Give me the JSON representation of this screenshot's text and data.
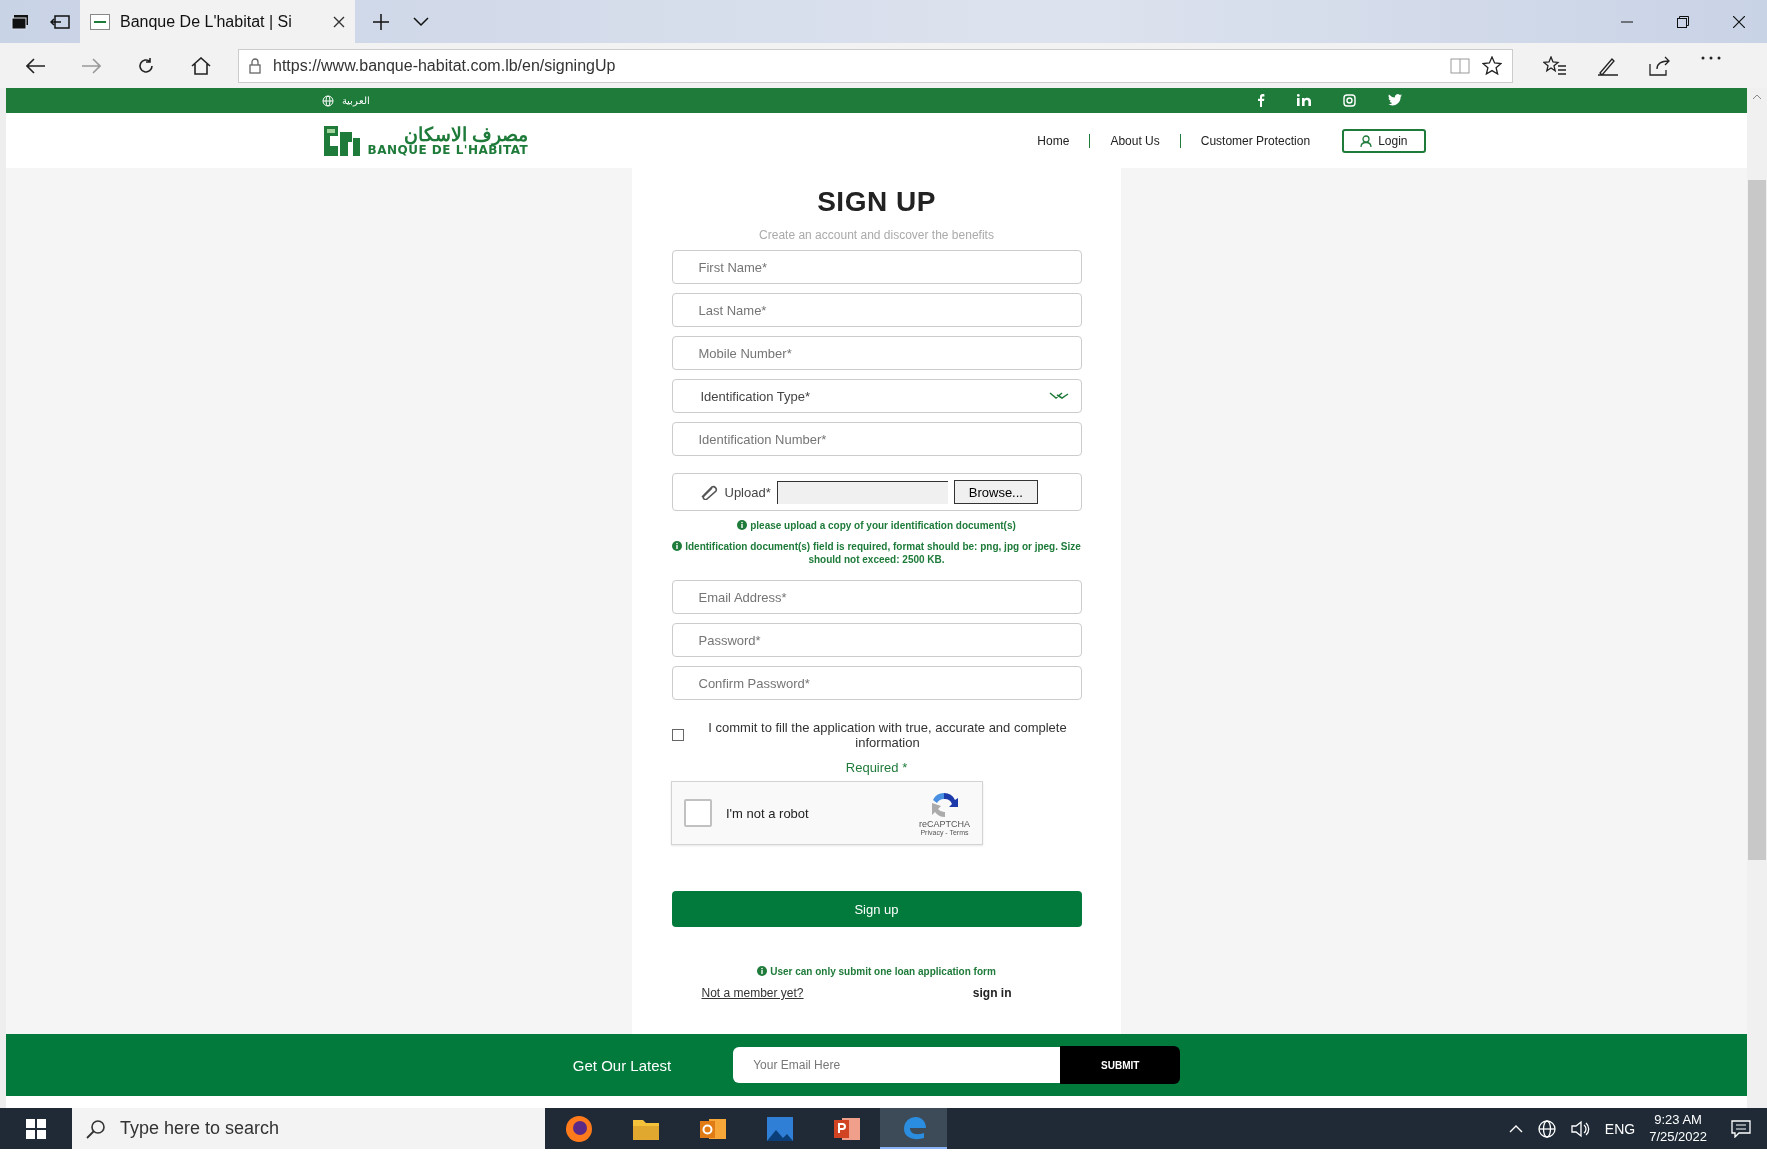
{
  "browser": {
    "tab_title": "Banque De L'habitat | Si",
    "url": "https://www.banque-habitat.com.lb/en/signingUp"
  },
  "top_bar": {
    "language": "العربية"
  },
  "header": {
    "logo_arabic": "مصرف الاسكان",
    "logo_latin": "BANQUE DE L'HABITAT",
    "nav": [
      "Home",
      "About Us",
      "Customer Protection"
    ],
    "login": "Login"
  },
  "form": {
    "title": "SIGN UP",
    "subtitle": "Create an account and discover the benefits",
    "fields": [
      {
        "kind": "text",
        "placeholder": "First Name*"
      },
      {
        "kind": "text",
        "placeholder": "Last Name*"
      },
      {
        "kind": "text",
        "placeholder": "Mobile Number*"
      },
      {
        "kind": "select",
        "placeholder": "Identification Type*"
      },
      {
        "kind": "text",
        "placeholder": "Identification Number*"
      },
      {
        "kind": "upload",
        "label": "Upload*",
        "button": "Browse..."
      }
    ],
    "upload_notes": [
      "please upload a copy of your identification document(s)",
      "Identification document(s) field is required, format should be: png, jpg or jpeg. Size should not exceed: 2500 KB."
    ],
    "fields_2": [
      {
        "kind": "text",
        "placeholder": "Email Address*"
      },
      {
        "kind": "text",
        "placeholder": "Password*"
      },
      {
        "kind": "text",
        "placeholder": "Confirm Password*"
      }
    ],
    "commit": {
      "label": "I commit to fill the application with true, accurate and complete information",
      "checked": false
    },
    "required": "Required *",
    "captcha": {
      "label": "I'm not a robot",
      "checked": false,
      "brand": "reCAPTCHA",
      "links": "Privacy - Terms"
    },
    "submit": "Sign up",
    "note": "User can only submit one loan application form",
    "not_member": "Not a member yet?",
    "sign_in": "sign in"
  },
  "footer": {
    "label": "Get Our Latest",
    "placeholder": "Your Email Here",
    "button": "SUBMIT"
  },
  "taskbar": {
    "search_placeholder": "Type here to search",
    "apps": [
      {
        "kind": "firefox",
        "selected": false
      },
      {
        "kind": "folder",
        "selected": false
      },
      {
        "kind": "outlook",
        "selected": false
      },
      {
        "kind": "photos",
        "selected": false
      },
      {
        "kind": "powerpoint",
        "selected": false
      },
      {
        "kind": "edge",
        "selected": true
      }
    ],
    "language": "ENG",
    "time": "9:23 AM",
    "date": "7/25/2022"
  }
}
